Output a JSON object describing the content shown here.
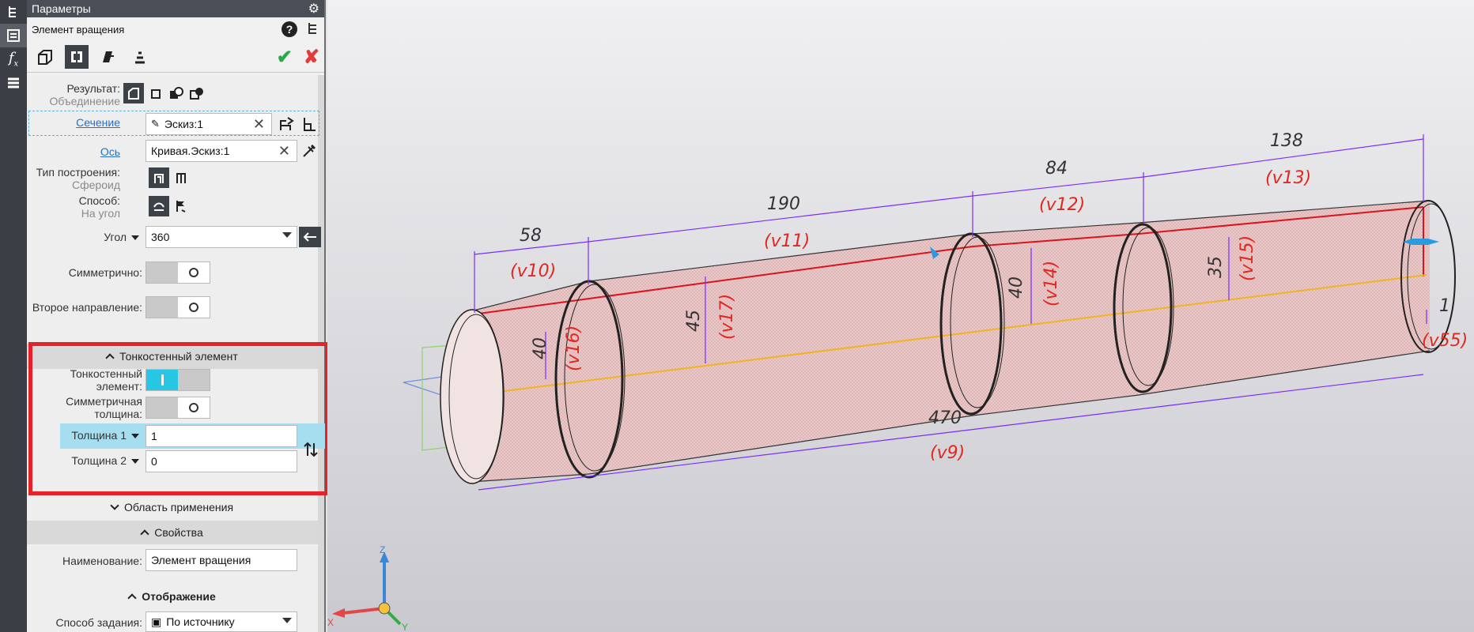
{
  "panel": {
    "title": "Параметры",
    "element_name": "Элемент вращения",
    "result_label": "Результат:",
    "result_value": "Объединение",
    "section_label": "Сечение",
    "section_value": "Эскиз:1",
    "axis_label": "Ось",
    "axis_value": "Кривая.Эскиз:1",
    "build_type_label": "Тип построения:",
    "build_type_value": "Сфероид",
    "method_label": "Способ:",
    "method_value": "На угол",
    "angle_label": "Угол",
    "angle_value": "360",
    "symmetric_label": "Симметрично:",
    "second_direction_label": "Второе направление:",
    "thin_section_title": "Тонкостенный элемент",
    "thin_element_label": "Тонкостенный элемент:",
    "thin_element_on": true,
    "symmetric_thickness_label": "Симметричная толщина:",
    "thickness1_label": "Толщина 1",
    "thickness1_value": "1",
    "thickness2_label": "Толщина 2",
    "thickness2_value": "0",
    "area_section_title": "Область применения",
    "properties_section_title": "Свойства",
    "name_label": "Наименование:",
    "name_value": "Элемент вращения",
    "display_section_title": "Отображение",
    "display_method_label": "Способ задания:",
    "display_method_value": "По источнику"
  },
  "dimensions": {
    "d58": "58",
    "v10": "(v10)",
    "d190": "190",
    "v11": "(v11)",
    "d84": "84",
    "v12": "(v12)",
    "d138": "138",
    "v13": "(v13)",
    "d40a": "40",
    "v16": "(v16)",
    "d45": "45",
    "v17": "(v17)",
    "d40b": "40",
    "v14": "(v14)",
    "d35": "35",
    "v15": "(v15)",
    "d1": "1",
    "v55": "(v55)",
    "d470": "470",
    "v9": "(v9)"
  },
  "axis_labels": {
    "z": "Z",
    "x": "X",
    "y": "Y"
  },
  "colors": {
    "accent": "#26c6e4",
    "highlight_box": "#e3222a",
    "dimension": "#7a2cff",
    "dimension_var": "#e0281f",
    "axis_line": "#f2b322",
    "edge_red": "#d9141b"
  }
}
